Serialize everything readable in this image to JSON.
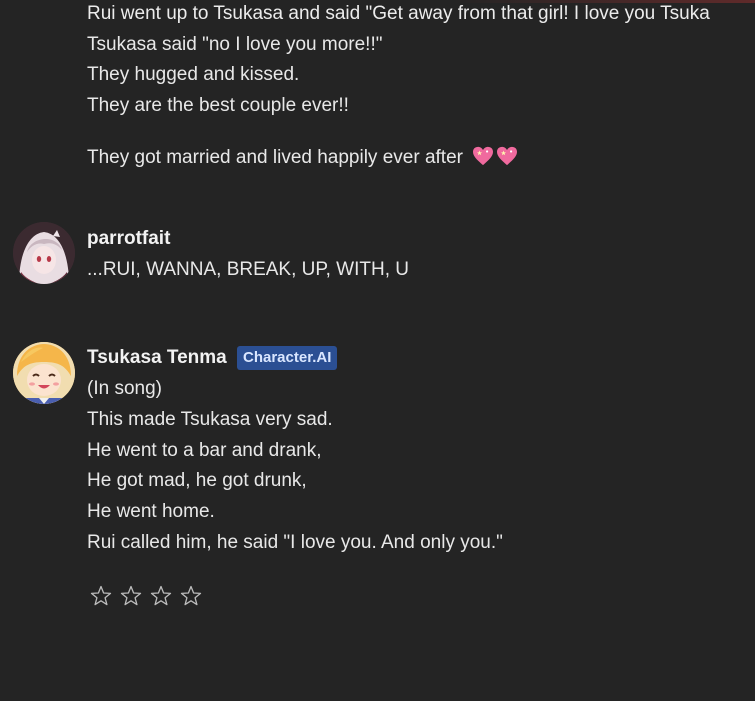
{
  "story_message": {
    "lines": [
      "Rui went up to Tsukasa and said \"Get away from that girl! I love you Tsuka",
      "Tsukasa said \"no I love you more!!\"",
      "They hugged and kissed.",
      "They are the best couple ever!!",
      "They got married and lived happily ever after"
    ],
    "emoji": "💖💖"
  },
  "user_message": {
    "author": "parrotfait",
    "text": "...RUI, WANNA, BREAK, UP, WITH, U"
  },
  "character_message": {
    "author": "Tsukasa Tenma",
    "badge": "Character.AI",
    "lines": [
      "(In song)",
      "This made Tsukasa very sad.",
      "He went to a bar and drank,",
      "He got mad, he got drunk,",
      "He went home.",
      "Rui called him, he said \"I love you. And only you.\""
    ]
  },
  "rating": {
    "stars": [
      "☆",
      "☆",
      "☆",
      "☆"
    ]
  },
  "colors": {
    "background": "#242424",
    "text": "#e8e8e8",
    "badge_bg": "#2b4f93",
    "heart": "#f36fa0"
  }
}
